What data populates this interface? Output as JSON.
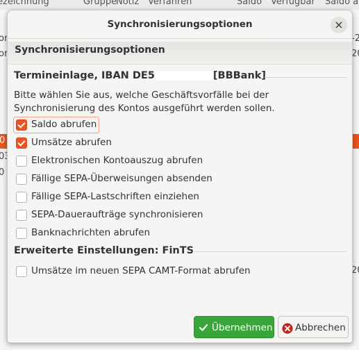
{
  "background": {
    "header_columns": [
      "ezeichnung",
      "Gruppe",
      "Notiz",
      "Verfahren",
      "Saldo",
      "Verfügbar",
      "Saldo a"
    ],
    "left_fragments": [
      "on",
      "or",
      "0",
      "03",
      "0"
    ],
    "right_fragments": [
      "-20",
      "20",
      "20"
    ]
  },
  "dialog": {
    "window_title": "Synchronisierungsoptionen",
    "close_label": "×",
    "header_label": "Synchronisierungsoptionen",
    "account_section": {
      "prefix": "Termineinlage, IBAN DE5",
      "suffix": "[BBBank]"
    },
    "description": "Bitte wählen Sie aus, welche Geschäftsvorfälle bei der Synchronisierung des Kontos ausgeführt werden sollen.",
    "options": [
      {
        "label": "Saldo abrufen",
        "checked": true
      },
      {
        "label": "Umsätze abrufen",
        "checked": true
      },
      {
        "label": "Elektronischen Kontoauszug abrufen",
        "checked": false
      },
      {
        "label": "Fällige SEPA-Überweisungen absenden",
        "checked": false
      },
      {
        "label": "Fällige SEPA-Lastschriften einziehen",
        "checked": false
      },
      {
        "label": "SEPA-Daueraufträge synchronisieren",
        "checked": false
      },
      {
        "label": "Banknachrichten abrufen",
        "checked": false
      }
    ],
    "advanced_section": "Erweiterte Einstellungen: FinTS",
    "advanced_options": [
      {
        "label": "Umsätze im neuen SEPA CAMT-Format abrufen",
        "checked": false
      }
    ],
    "ok_button": "Übernehmen",
    "cancel_button": "Abbrechen"
  },
  "colors": {
    "accent": "#e95420",
    "ok_green": "#3aa63a",
    "cancel_red": "#d02020"
  }
}
